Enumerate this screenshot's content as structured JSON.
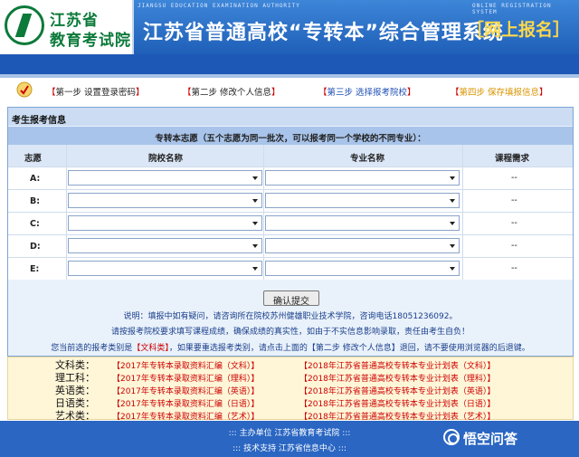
{
  "header": {
    "logo_line1": "江苏省",
    "logo_line2": "教育考试院",
    "org_en": "JIANGSU EDUCATION EXAMINATION AUTHORITY",
    "system_en": "ONLINE REGISTRATION SYSTEM",
    "title": "江苏省普通高校“专转本”综合管理系统",
    "badge": "［网上报名］"
  },
  "steps": [
    {
      "label": "第一步  设置登录密码",
      "open": "【",
      "close": "】"
    },
    {
      "label": "第二步  修改个人信息",
      "open": "【",
      "close": "】"
    },
    {
      "label": "第三步  选择报考院校",
      "open": "【",
      "close": "】"
    },
    {
      "label": "第四步  保存填报信息",
      "open": "【",
      "close": "】"
    }
  ],
  "section": {
    "title": "考生报考信息",
    "caption": "专转本志愿（五个志愿为同一批次，可以报考同一个学校的不同专业）：",
    "columns": [
      "志愿",
      "院校名称",
      "专业名称",
      "课程需求"
    ],
    "rows": [
      {
        "label": "A:",
        "req": "--"
      },
      {
        "label": "B:",
        "req": "--"
      },
      {
        "label": "C:",
        "req": "--"
      },
      {
        "label": "D:",
        "req": "--"
      },
      {
        "label": "E:",
        "req": "--"
      }
    ],
    "submit_label": "确认提交",
    "note1": "说明：填报中如有疑问，请咨询所在院校苏州健雄职业技术学院，咨询电话18051236092。",
    "note2": "请按报考院校要求填写课程成绩，确保成绩的真实性，如由于不实信息影响录取，责任由考生自负！",
    "note3_pre": "您当前选的报考类别是",
    "note3_cat": "【文科类】",
    "note3_post": "，如果要重选报考类别，请点击上面的【第二步 修改个人信息】退回，请不要使用浏览器的后退键。"
  },
  "downloads": [
    {
      "cat": "文科类：",
      "link1": "【2017年专转本录取资料汇编（文科）】",
      "link2": "【2018年江苏省普通高校专转本专业计划表（文科）】"
    },
    {
      "cat": "理工科：",
      "link1": "【2017年专转本录取资料汇编（理科）】",
      "link2": "【2018年江苏省普通高校专转本专业计划表（理科）】"
    },
    {
      "cat": "英语类：",
      "link1": "【2017年专转本录取资料汇编（英语）】",
      "link2": "【2018年江苏省普通高校专转本专业计划表（英语）】"
    },
    {
      "cat": "日语类：",
      "link1": "【2017年专转本录取资料汇编（日语）】",
      "link2": "【2018年江苏省普通高校专转本专业计划表（日语）】"
    },
    {
      "cat": "艺术类：",
      "link1": "【2017年专转本录取资料汇编（艺术）】",
      "link2": "【2018年江苏省普通高校专转本专业计划表（艺术）】"
    }
  ],
  "footer": {
    "line1": "::: 主办单位  江苏省教育考试院 :::",
    "line2": "::: 技术支持  江苏省信息中心 :::"
  },
  "watermark": "悟空问答",
  "colors": {
    "header_blue": "#1e58b6",
    "link_red": "#cc0000",
    "step3_blue": "#1f4fb5",
    "step4_gold": "#d89400"
  }
}
